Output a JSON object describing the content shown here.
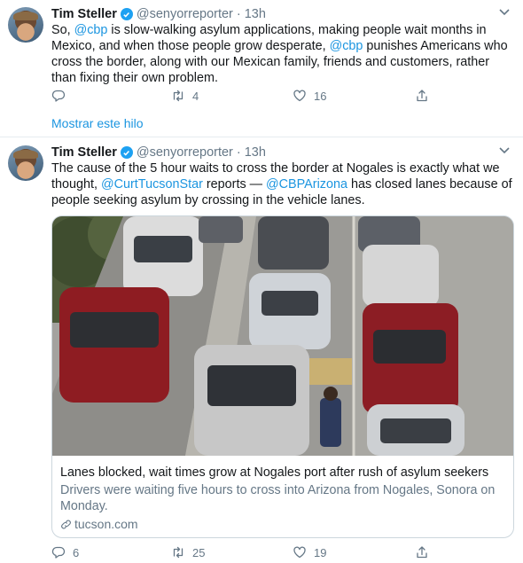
{
  "colors": {
    "link": "#1b95e0",
    "verified": "#1da1f2",
    "muted": "#657786",
    "text": "#14171a",
    "border": "#e6ecf0"
  },
  "tweets": [
    {
      "name": "Tim Steller",
      "handle": "@senyorreporter",
      "separator": "·",
      "time": "13h",
      "text_parts": [
        {
          "t": "So, ",
          "link": false
        },
        {
          "t": "@cbp",
          "link": true
        },
        {
          "t": " is slow-walking asylum applications, making people wait months in Mexico, and when those people grow desperate, ",
          "link": false
        },
        {
          "t": "@cbp",
          "link": true
        },
        {
          "t": " punishes Americans who cross the border, along with our Mexican family, friends and customers, rather than fixing their own problem.",
          "link": false
        }
      ],
      "replies": "",
      "retweets": "4",
      "likes": "16",
      "show_thread": "Mostrar este hilo"
    },
    {
      "name": "Tim Steller",
      "handle": "@senyorreporter",
      "separator": "·",
      "time": "13h",
      "text_parts": [
        {
          "t": "The cause of the 5 hour waits to cross the border at Nogales is exactly what we thought, ",
          "link": false
        },
        {
          "t": "@CurtTucsonStar",
          "link": true
        },
        {
          "t": " reports — ",
          "link": false
        },
        {
          "t": "@CBPArizona",
          "link": true
        },
        {
          "t": " has closed lanes because of people seeking asylum by crossing in the vehicle lanes.",
          "link": false
        }
      ],
      "card": {
        "title": "Lanes blocked, wait times grow at Nogales port after rush of asylum seekers",
        "description": "Drivers were waiting five hours to cross into Arizona from Nogales, Sonora on Monday.",
        "domain": "tucson.com"
      },
      "replies": "6",
      "retweets": "25",
      "likes": "19"
    }
  ],
  "icons": {
    "verified": "verified-badge-icon",
    "caret": "chevron-down-icon",
    "reply": "reply-icon",
    "retweet": "retweet-icon",
    "like": "heart-icon",
    "share": "share-icon",
    "link": "link-icon"
  }
}
